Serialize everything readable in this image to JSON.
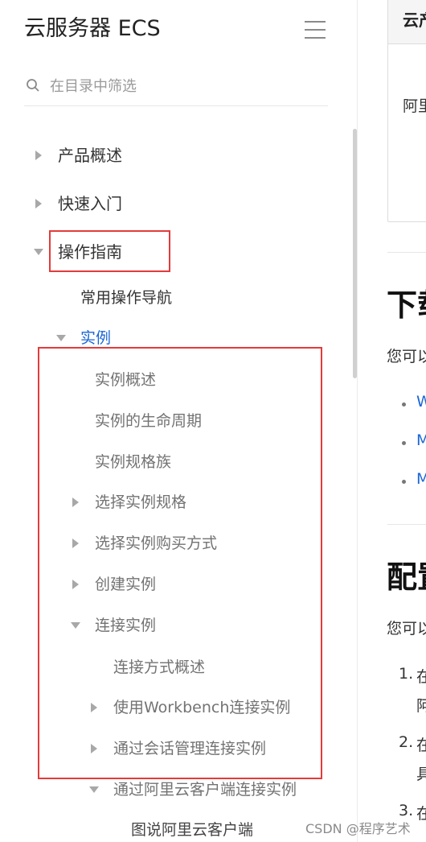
{
  "sidebar": {
    "title": "云服务器 ECS",
    "filter_placeholder": "在目录中筛选",
    "items": [
      {
        "label": "产品概述"
      },
      {
        "label": "快速入门"
      },
      {
        "label": "操作指南"
      },
      {
        "label": "常用操作导航"
      },
      {
        "label": "实例"
      },
      {
        "label": "实例概述"
      },
      {
        "label": "实例的生命周期"
      },
      {
        "label": "实例规格族"
      },
      {
        "label": "选择实例规格"
      },
      {
        "label": "选择实例购买方式"
      },
      {
        "label": "创建实例"
      },
      {
        "label": "连接实例"
      },
      {
        "label": "连接方式概述"
      },
      {
        "label": "使用Workbench连接实例"
      },
      {
        "label": "通过会话管理连接实例"
      },
      {
        "label": "通过阿里云客户端连接实例"
      }
    ],
    "caption": "图说阿里云客户端"
  },
  "content": {
    "card_head": "云产",
    "card_body": "阿里",
    "heading1": "下载",
    "para1": "您可以",
    "links": [
      "W",
      "M",
      "M"
    ],
    "heading2": "配置",
    "para2": "您可以",
    "steps": [
      {
        "num": "1.",
        "text": "在",
        "cont": "阿"
      },
      {
        "num": "2.",
        "text": "在",
        "cont": "具"
      },
      {
        "num": "3.",
        "text": "在"
      }
    ]
  },
  "watermark": "CSDN @程序艺术",
  "colors": {
    "highlight": "#e33b3b",
    "active": "#1a66d6",
    "caret": "#a8a8a8"
  }
}
